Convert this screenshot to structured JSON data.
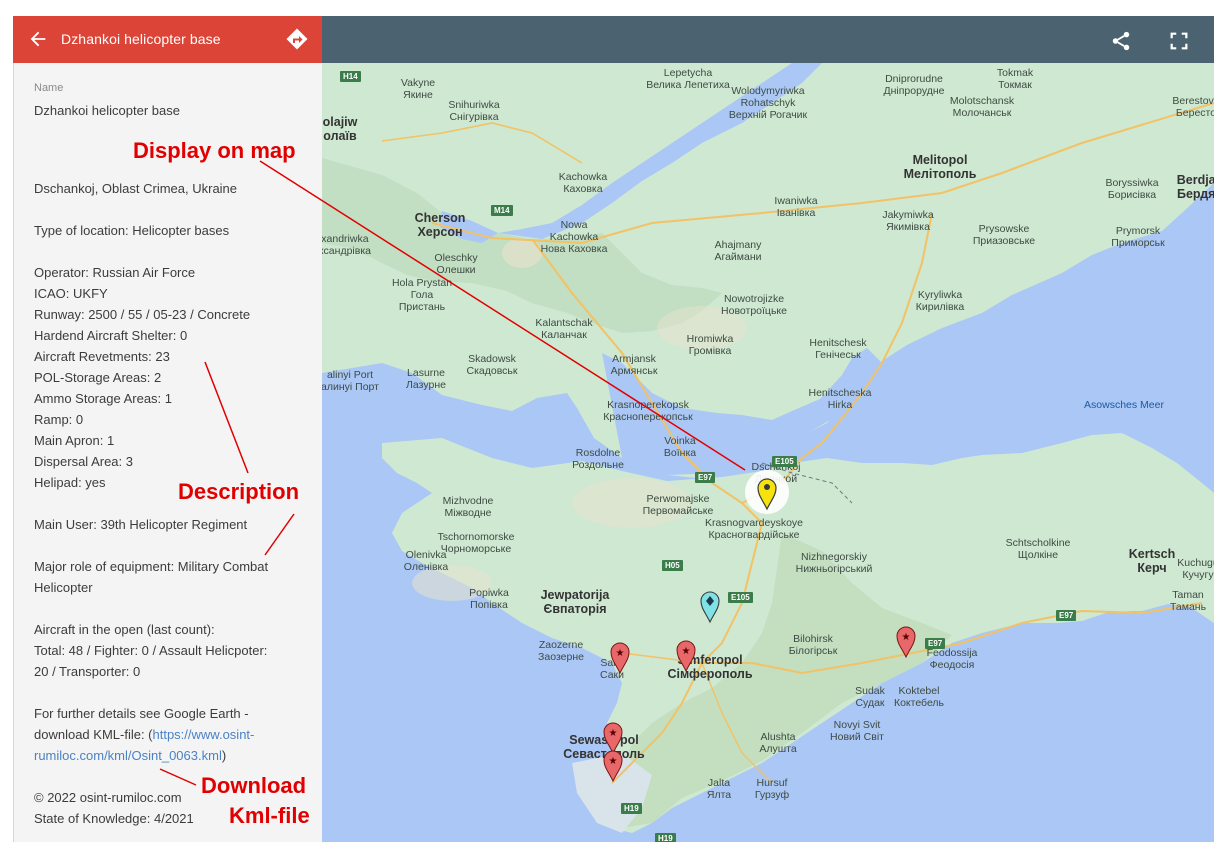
{
  "header": {
    "title": "Dzhankoi helicopter base"
  },
  "side": {
    "name_label": "Name",
    "name_value": "Dzhankoi helicopter base",
    "lines": [
      "Dschankoj, Oblast Crimea, Ukraine",
      "Type of location: Helicopter bases",
      "Operator: Russian Air Force",
      "ICAO: UKFY",
      "Runway: 2500 / 55 / 05-23 / Concrete",
      "Hardend Aircraft Shelter: 0",
      "Aircraft Revetments: 23",
      "POL-Storage Areas: 2",
      "Ammo Storage Areas: 1",
      "Ramp: 0",
      "Main Apron: 1",
      "Dispersal Area: 3",
      "Helipad: yes",
      "Main User: 39th Helicopter Regiment",
      "Major role of equipment: Military Combat",
      "Helicopter",
      "Aircraft in the open (last count):",
      "Total: 48 / Fighter: 0 / Assault Helicpoter:",
      "20 / Transporter: 0",
      "For further details see Google Earth -",
      "download KML-file: (",
      "https://www.osint-",
      "rumiloc.com/kml/Osint_0063.kml",
      ")",
      "© 2022 osint-rumiloc.com",
      "State of Knowledge: 4/2021"
    ]
  },
  "annotations": {
    "display": "Display on map",
    "description": "Description",
    "download_1": "Download",
    "download_2": "Kml-file"
  },
  "map": {
    "labels": [
      [
        "Vakyne",
        "Якинe"
      ],
      [
        "Lepetycha",
        "Велика Лепетиха"
      ],
      [
        "Dniprorudne",
        "Дніпрорудне"
      ],
      [
        "Tokmak",
        "Токмак"
      ],
      [
        "Snihuriwka",
        "Снігурівка"
      ],
      [
        "Wolodymyriwka",
        "Rohatschyk",
        "Верхній Рогачик"
      ],
      [
        "Molotschansk",
        "Молочанськ"
      ],
      [
        "Berestove",
        "Бересто"
      ],
      [
        "olajiw",
        "олаїв"
      ],
      [
        "Melitopol",
        "Мелітополь"
      ],
      [
        "Kachowka",
        "Каховка"
      ],
      [
        "Iwaniwka",
        "Іванівка"
      ],
      [
        "Boryssiwka",
        "Борисівка"
      ],
      [
        "Berdjan",
        "Бердян"
      ],
      [
        "Cherson",
        "Херсон"
      ],
      [
        "Nowa",
        "Kachowka",
        "Нова Каховка"
      ],
      [
        "Jakymiwka",
        "Якимівка"
      ],
      [
        "Prysowske",
        "Приазовське"
      ],
      [
        "Prymorsk",
        "Приморськ"
      ],
      [
        "exandriwka",
        "ександрівка"
      ],
      [
        "Oleschky",
        "Олешки"
      ],
      [
        "Ahajmany",
        "Агаймани"
      ],
      [
        "Hola Prystan",
        "Гола",
        "Пристань"
      ],
      [
        "Kyryliwka",
        "Кирилівка"
      ],
      [
        "Nowotrojizke",
        "Новотроїцьке"
      ],
      [
        "Kalantschak",
        "Каланчак"
      ],
      [
        "Hromiwka",
        "Громівка"
      ],
      [
        "Henitschesk",
        "Генічеськ"
      ],
      [
        "Skadowsk",
        "Скадовськ"
      ],
      [
        "Armjansk",
        "Армянськ"
      ],
      [
        "alinyi Port",
        "алинyi Порт"
      ],
      [
        "Lasurne",
        "Лазурне"
      ],
      [
        "Henitscheska",
        "Hirka",
        "Генічеська",
        "Гірка"
      ],
      [
        "Krasnoperekopsk",
        "Красноперекопськ"
      ],
      [
        "Asowsches Meer"
      ],
      [
        "Rosdolne",
        "Роздольне"
      ],
      [
        "Voinka",
        "Воїнка"
      ],
      [
        "Dschankoj",
        "Джанкой"
      ],
      [
        "Mizhvodne",
        "Міжводне"
      ],
      [
        "Perwomajske",
        "Первомайське"
      ],
      [
        "Krasnogvardeyskoye",
        "Красногвардійське"
      ],
      [
        "Schtscholkine",
        "Щолкіне"
      ],
      [
        "Tschornomorske",
        "Чорноморське"
      ],
      [
        "Kertsch",
        "Керч"
      ],
      [
        "Kuchugu",
        "Кучугу"
      ],
      [
        "Olenivka",
        "Оленівка"
      ],
      [
        "Nizhnegorskiy",
        "Нижньогірський"
      ],
      [
        "Popiwka",
        "Попівка"
      ],
      [
        "Jewpatorija",
        "Євпаторія"
      ],
      [
        "Taman",
        "Тамань"
      ],
      [
        "Zaozerne",
        "Заозерне"
      ],
      [
        "Saky",
        "Саки"
      ],
      [
        "Simferopol",
        "Сімферополь"
      ],
      [
        "Bilohirsk",
        "Білогірськ"
      ],
      [
        "Feodossija",
        "Феодосія"
      ],
      [
        "Sudak",
        "Судак"
      ],
      [
        "Koktebel",
        "Коктебель"
      ],
      [
        "Novyi Svit",
        "Новий Світ"
      ],
      [
        "Alushta",
        "Алушта"
      ],
      [
        "Sewastopol",
        "Севастополь"
      ],
      [
        "Jalta",
        "Ялта"
      ],
      [
        "Hursuf",
        "Гурзуф"
      ]
    ],
    "roads": [
      "H14",
      "M14",
      "E105",
      "E97",
      "H05",
      "E105",
      "E97",
      "E97",
      "H19",
      "H19"
    ]
  }
}
